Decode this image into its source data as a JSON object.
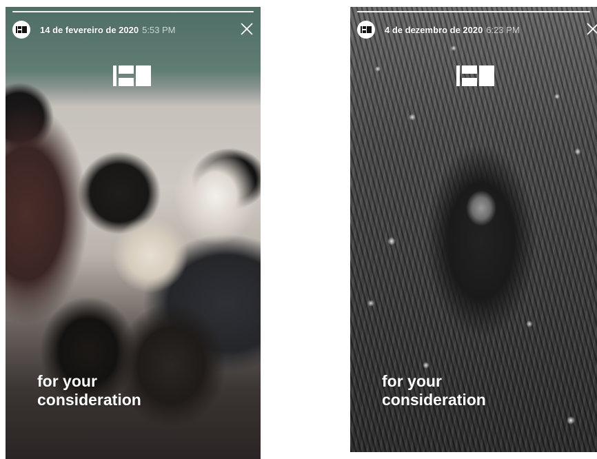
{
  "stories": [
    {
      "date": "14 de fevereiro de 2020",
      "time": "5:53 PM",
      "progress": 1.0,
      "caption_line1": "for your",
      "caption_line2": "consideration"
    },
    {
      "date": "4 de dezembro de 2020",
      "time": "6:23 PM",
      "progress": 1.0,
      "caption_line1": "for your",
      "caption_line2": "consideration"
    }
  ],
  "icons": {
    "avatar": "brand-logo-icon",
    "close": "close-icon",
    "center": "brand-logo-icon"
  },
  "colors": {
    "text": "#ffffff",
    "time_text": "rgba(255,255,255,0.7)"
  }
}
